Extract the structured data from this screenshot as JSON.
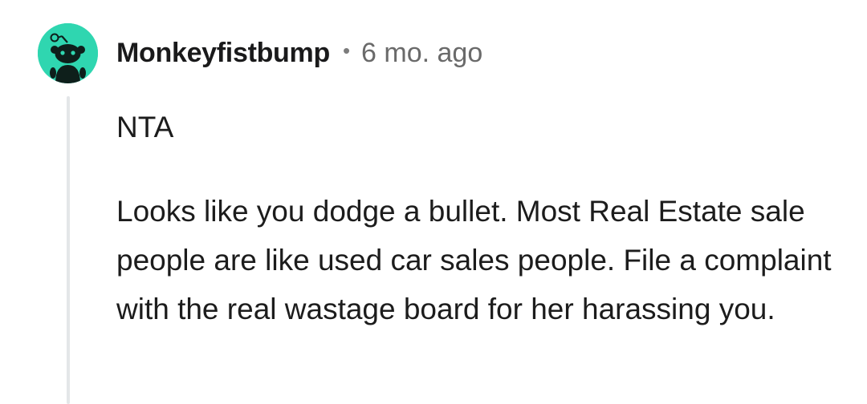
{
  "comment": {
    "author": "Monkeyfistbump",
    "separator": "•",
    "age": "6 mo. ago",
    "paragraphs": [
      "NTA",
      "Looks like you dodge a bullet. Most Real Estate sale people are like used car sales people. File a complaint with the real wastage board for her harassing you."
    ],
    "avatar": {
      "icon": "snoo-avatar-icon",
      "background_color": "#2fd6b0",
      "figure_color": "#0e1f1b"
    },
    "thread_line_color": "#e4e6e8"
  }
}
